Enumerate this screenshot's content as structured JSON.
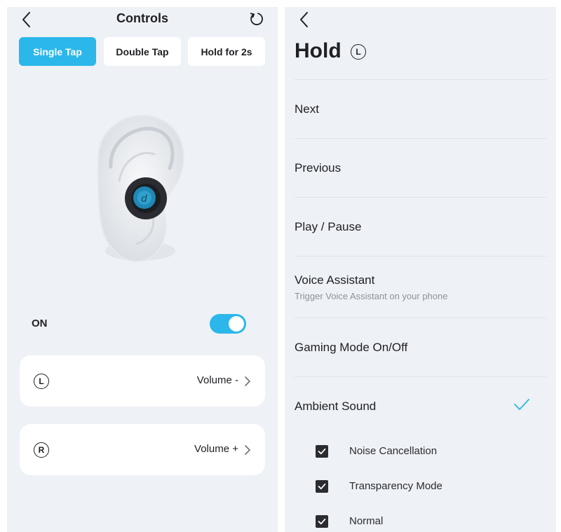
{
  "left": {
    "header": {
      "title": "Controls"
    },
    "tabs": [
      {
        "label": "Single Tap",
        "active": true
      },
      {
        "label": "Double Tap",
        "active": false
      },
      {
        "label": "Hold for 2s",
        "active": false
      }
    ],
    "switch": {
      "label": "ON",
      "state": "on"
    },
    "buttons": [
      {
        "side": "L",
        "action": "Volume -"
      },
      {
        "side": "R",
        "action": "Volume +"
      }
    ]
  },
  "right": {
    "header": {
      "title": "Hold",
      "side": "L"
    },
    "options": [
      {
        "label": "Next"
      },
      {
        "label": "Previous"
      },
      {
        "label": "Play / Pause"
      },
      {
        "label": "Voice Assistant",
        "sublabel": "Trigger Voice Assistant on your phone"
      },
      {
        "label": "Gaming Mode On/Off"
      },
      {
        "label": "Ambient Sound",
        "selected": true
      }
    ],
    "ambient_modes": [
      {
        "label": "Noise Cancellation",
        "checked": true
      },
      {
        "label": "Transparency Mode",
        "checked": true
      },
      {
        "label": "Normal",
        "checked": true
      }
    ]
  },
  "colors": {
    "accent": "#2bb7ea",
    "panel_bg": "#eef1f5",
    "text": "#1f1f24",
    "subtext": "#8d939b"
  },
  "icons": [
    "back-icon",
    "reset-icon",
    "chevron-right-icon",
    "checkmark-icon",
    "checkbox-checked-icon",
    "earbud-in-ear-image"
  ]
}
